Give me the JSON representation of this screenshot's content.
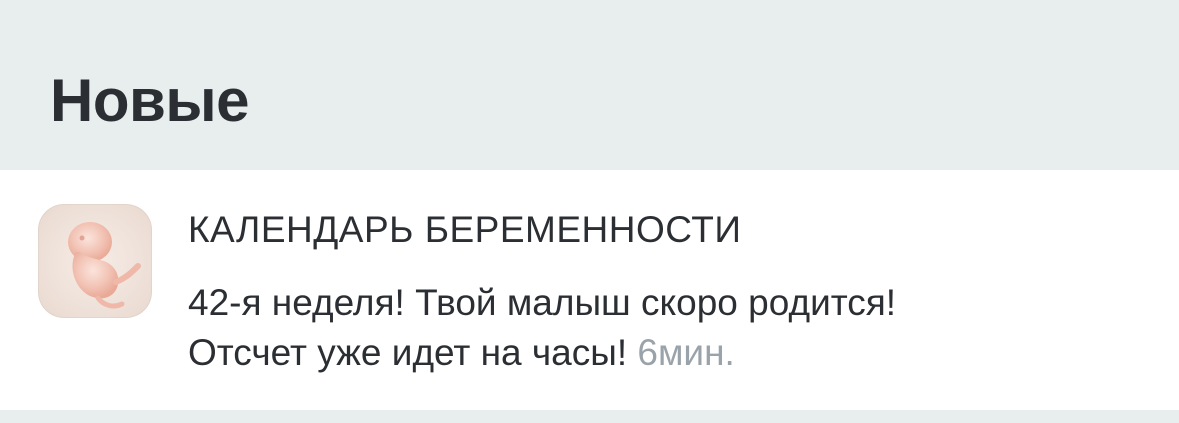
{
  "section": {
    "title": "Новые"
  },
  "notification": {
    "app_name": "КАЛЕНДАРЬ БЕРЕМЕННОСТИ",
    "icon": "fetus-icon",
    "message_line1": "42-я неделя! Твой малыш скоро родится!",
    "message_line2": "Отсчет уже идет на часы!",
    "time": "6мин."
  },
  "colors": {
    "background": "#e8eeee",
    "card": "#ffffff",
    "text": "#2b2f33",
    "muted": "#9aa3aa"
  }
}
